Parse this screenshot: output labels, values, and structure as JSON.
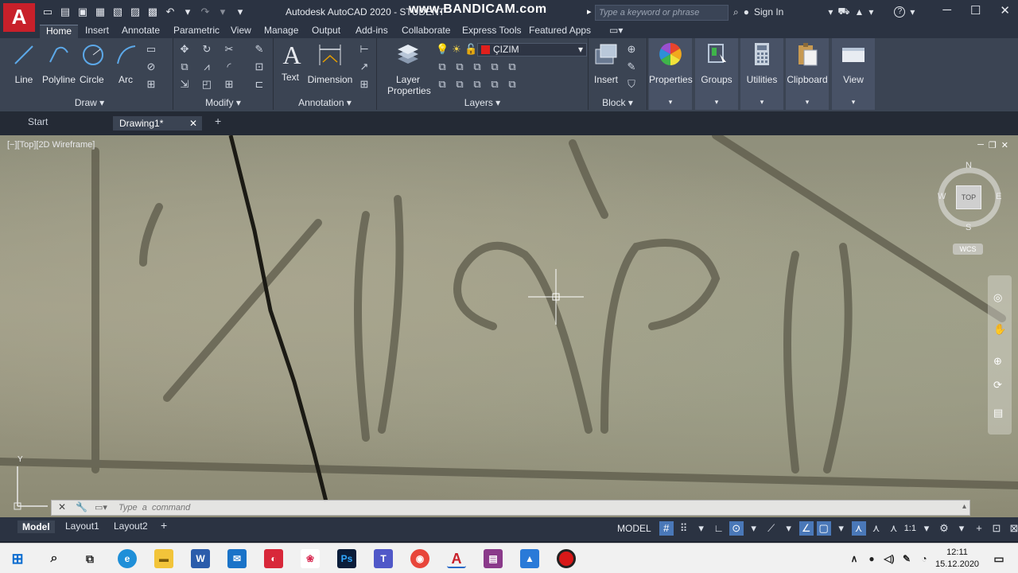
{
  "app": {
    "logo_letter": "A",
    "title": "Autodesk AutoCAD 2020 - STUDENT",
    "brand_overlay": "www.BANDICAM.com",
    "title_suffix": "▸",
    "search_placeholder": "Type a keyword or phrase",
    "sign_in": "Sign In",
    "help": "?"
  },
  "ribbon_tabs": [
    "Home",
    "Insert",
    "Annotate",
    "Parametric",
    "View",
    "Manage",
    "Output",
    "Add-ins",
    "Collaborate",
    "Express Tools",
    "Featured Apps"
  ],
  "draw_panel": {
    "title": "Draw",
    "tools": [
      "Line",
      "Polyline",
      "Circle",
      "Arc"
    ]
  },
  "modify_panel": {
    "title": "Modify"
  },
  "annotation_panel": {
    "title": "Annotation",
    "tools": [
      "Text",
      "Dimension"
    ]
  },
  "layers_panel": {
    "title": "Layers",
    "layer_properties": "Layer Properties",
    "current_layer": "ÇIZIM",
    "current_layer_color": "#e0201c"
  },
  "block_panel": {
    "title": "Block",
    "insert": "Insert"
  },
  "dark_buttons": [
    "Properties",
    "Groups",
    "Utilities",
    "Clipboard",
    "View"
  ],
  "doc_tabs": {
    "start": "Start",
    "active": "Drawing1*",
    "close": "✕",
    "add": "+"
  },
  "viewport": {
    "label": "[−][Top][2D Wireframe]",
    "viewcube": {
      "n": "N",
      "s": "S",
      "e": "E",
      "w": "W",
      "face": "TOP",
      "wcs": "WCS"
    },
    "ucs_y": "Y"
  },
  "command_line": {
    "placeholder": "Type  a  command"
  },
  "layout_tabs": [
    "Model",
    "Layout1",
    "Layout2"
  ],
  "status": {
    "mode": "MODEL",
    "scale": "1:1"
  },
  "clock": {
    "time": "12:11",
    "date": "15.12.2020"
  },
  "colors": {
    "autocad_red": "#c8202a",
    "ribbon_bg": "#3b4453",
    "titlebar_bg": "#2b3342"
  }
}
